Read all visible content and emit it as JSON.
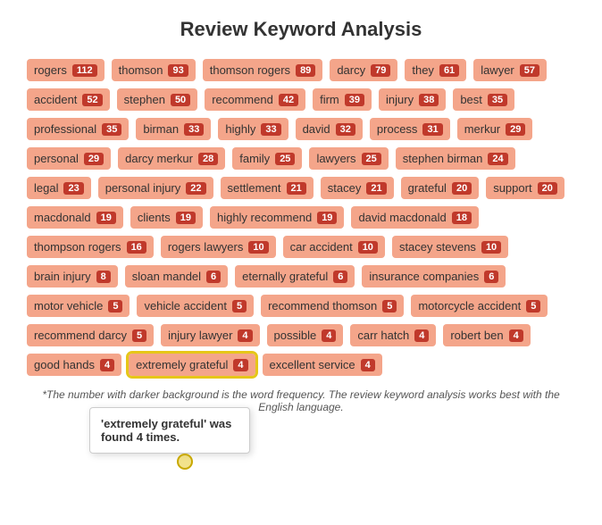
{
  "title": "Review Keyword Analysis",
  "keywords": [
    {
      "label": "rogers",
      "count": 112
    },
    {
      "label": "thomson",
      "count": 93
    },
    {
      "label": "thomson rogers",
      "count": 89
    },
    {
      "label": "darcy",
      "count": 79
    },
    {
      "label": "they",
      "count": 61
    },
    {
      "label": "lawyer",
      "count": 57
    },
    {
      "label": "accident",
      "count": 52
    },
    {
      "label": "stephen",
      "count": 50
    },
    {
      "label": "recommend",
      "count": 42
    },
    {
      "label": "firm",
      "count": 39
    },
    {
      "label": "injury",
      "count": 38
    },
    {
      "label": "best",
      "count": 35
    },
    {
      "label": "professional",
      "count": 35
    },
    {
      "label": "birman",
      "count": 33
    },
    {
      "label": "highly",
      "count": 33
    },
    {
      "label": "david",
      "count": 32
    },
    {
      "label": "process",
      "count": 31
    },
    {
      "label": "merkur",
      "count": 29
    },
    {
      "label": "personal",
      "count": 29
    },
    {
      "label": "darcy merkur",
      "count": 28
    },
    {
      "label": "family",
      "count": 25
    },
    {
      "label": "lawyers",
      "count": 25
    },
    {
      "label": "stephen birman",
      "count": 24
    },
    {
      "label": "legal",
      "count": 23
    },
    {
      "label": "personal injury",
      "count": 22
    },
    {
      "label": "settlement",
      "count": 21
    },
    {
      "label": "stacey",
      "count": 21
    },
    {
      "label": "grateful",
      "count": 20
    },
    {
      "label": "support",
      "count": 20
    },
    {
      "label": "macdonald",
      "count": 19
    },
    {
      "label": "clients",
      "count": 19
    },
    {
      "label": "highly recommend",
      "count": 19
    },
    {
      "label": "david macdonald",
      "count": 18
    },
    {
      "label": "thompson rogers",
      "count": 16
    },
    {
      "label": "rogers lawyers",
      "count": 10
    },
    {
      "label": "car accident",
      "count": 10
    },
    {
      "label": "stacey stevens",
      "count": 10
    },
    {
      "label": "brain injury",
      "count": 8
    },
    {
      "label": "sloan mandel",
      "count": 6
    },
    {
      "label": "eternally grateful",
      "count": 6
    },
    {
      "label": "insurance companies",
      "count": 6
    },
    {
      "label": "motor vehicle",
      "count": 5
    },
    {
      "label": "vehicle accident",
      "count": 5
    },
    {
      "label": "recommend thomson",
      "count": 5
    },
    {
      "label": "motorcycle accident",
      "count": 5
    },
    {
      "label": "recommend darcy",
      "count": 5
    },
    {
      "label": "injury lawyer",
      "count": 4
    },
    {
      "label": "possible",
      "count": 4
    },
    {
      "label": "carr hatch",
      "count": 4
    },
    {
      "label": "robert ben",
      "count": 4
    },
    {
      "label": "good hands",
      "count": 4
    },
    {
      "label": "extremely grateful",
      "count": 4,
      "highlighted": true
    },
    {
      "label": "excellent service",
      "count": 4
    }
  ],
  "tooltip": {
    "text_part1": "'extremely grateful' was found ",
    "count": "4",
    "text_part2": " times."
  },
  "footer": "*The number with darker background is the word frequency. The review keyword analysis works best with the English language."
}
